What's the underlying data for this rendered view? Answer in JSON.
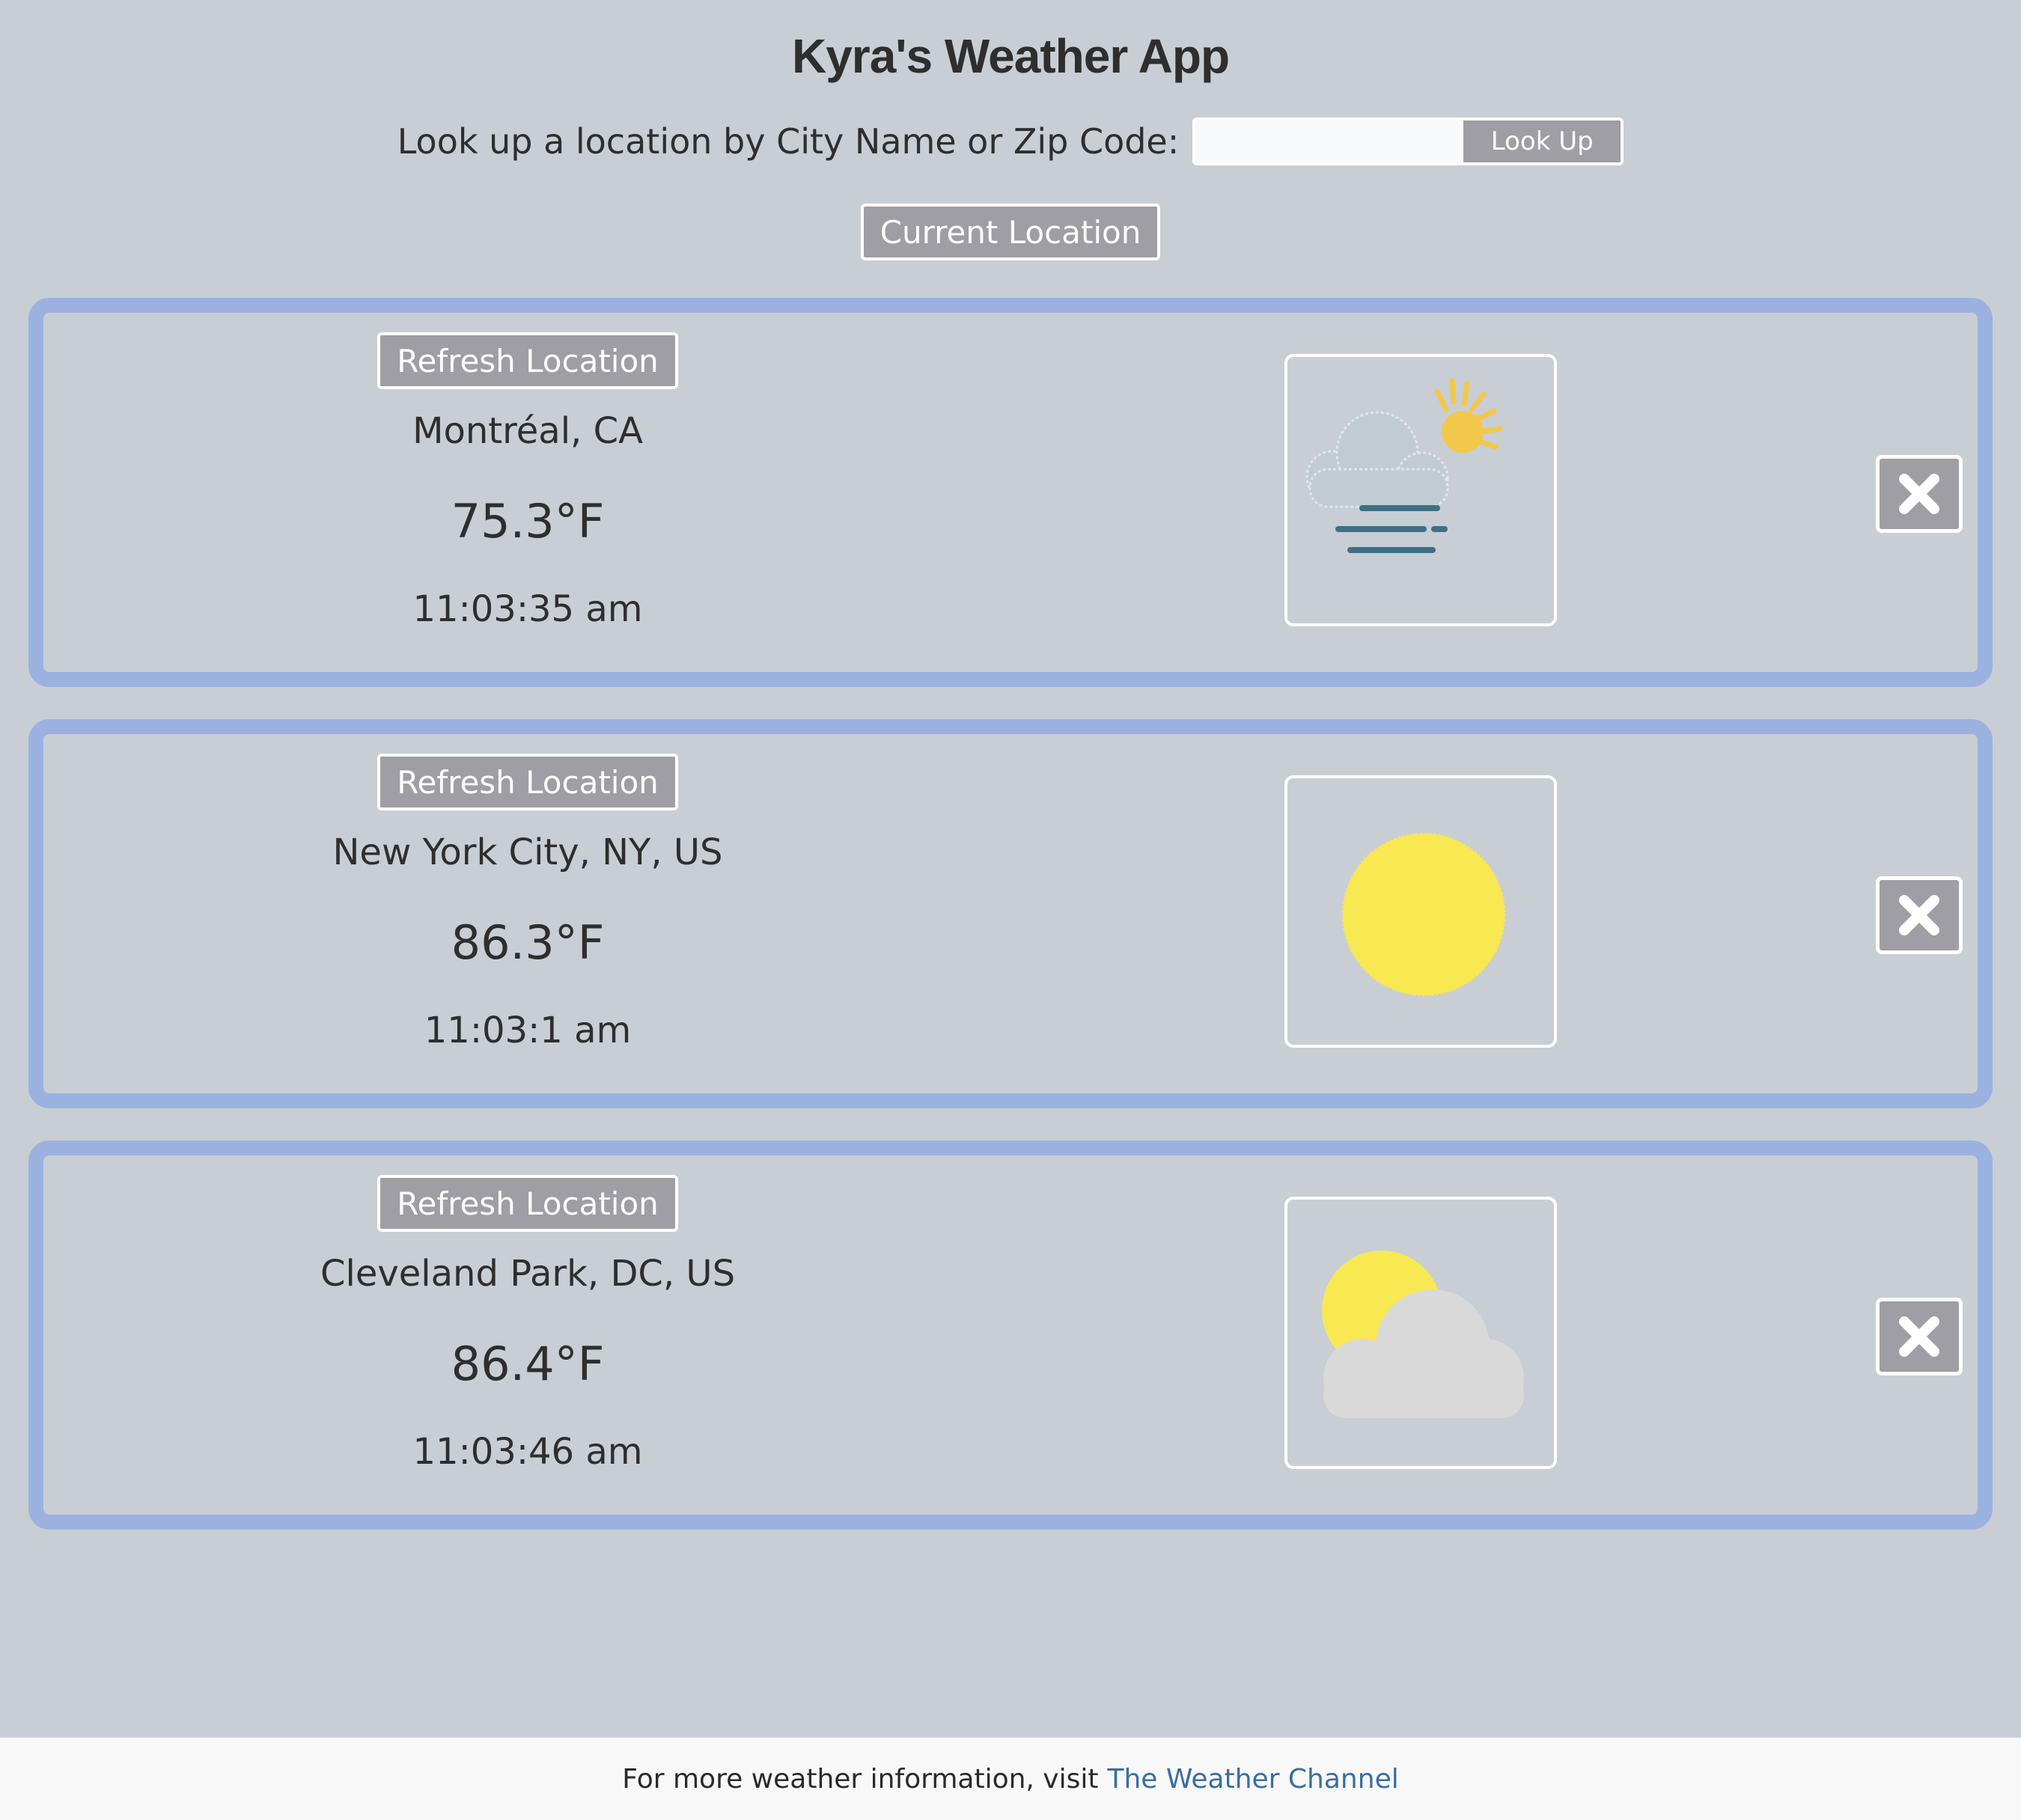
{
  "app": {
    "title": "Kyra's Weather App"
  },
  "search": {
    "label": "Look up a location by City Name or Zip Code:",
    "input_value": "",
    "button_label": "Look Up"
  },
  "current_location_label": "Current Location",
  "locations": [
    {
      "refresh_label": "Refresh Location",
      "city": "Montréal, CA",
      "temperature": "75.3°F",
      "time": "11:03:35 am",
      "icon": "fog-partly-sunny-icon"
    },
    {
      "refresh_label": "Refresh Location",
      "city": "New York City, NY, US",
      "temperature": "86.3°F",
      "time": "11:03:1 am",
      "icon": "sunny-icon"
    },
    {
      "refresh_label": "Refresh Location",
      "city": "Cleveland Park, DC, US",
      "temperature": "86.4°F",
      "time": "11:03:46 am",
      "icon": "partly-cloudy-icon"
    }
  ],
  "footer": {
    "text": "For more weather information, visit",
    "link_text": "The Weather Channel"
  },
  "colors": {
    "background": "#c8ced4",
    "card_border": "#9bb2e0",
    "button": "#9e9ea4",
    "link": "#3a6e9e",
    "sun": "#f8e952",
    "cloud": "#d9d9d9"
  }
}
